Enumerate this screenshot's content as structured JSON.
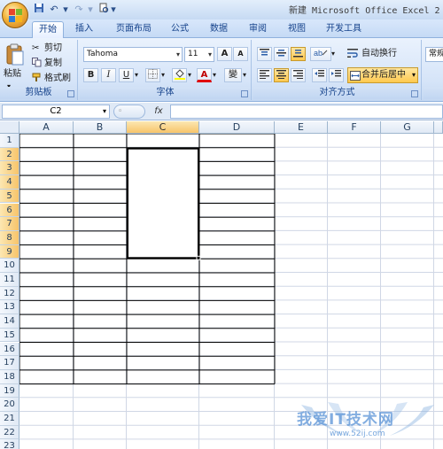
{
  "title": "新建 Microsoft Office Excel 2",
  "quick_access": {
    "undo_label": "↶",
    "redo_label": "↷",
    "more_label": "▾"
  },
  "tabs": [
    "开始",
    "插入",
    "页面布局",
    "公式",
    "数据",
    "审阅",
    "视图",
    "开发工具"
  ],
  "active_tab": "开始",
  "clipboard": {
    "paste": "粘贴",
    "cut": "剪切",
    "copy": "复制",
    "format_painter": "格式刷",
    "group": "剪贴板"
  },
  "font": {
    "name": "Tahoma",
    "size": "11",
    "grow": "A",
    "shrink": "A",
    "bold": "B",
    "italic": "I",
    "underline": "U",
    "phonetic": "變",
    "font_color": "A",
    "group": "字体"
  },
  "alignment": {
    "wrap_text": "自动换行",
    "merge_center": "合并后居中",
    "group": "对齐方式"
  },
  "number": {
    "format": "常规"
  },
  "formula_bar": {
    "name_box": "C2",
    "fx": "fx",
    "value": ""
  },
  "columns": [
    "A",
    "B",
    "C",
    "D",
    "E",
    "F",
    "G"
  ],
  "rows": [
    "1",
    "2",
    "3",
    "4",
    "5",
    "6",
    "7",
    "8",
    "9",
    "10",
    "11",
    "12",
    "13",
    "14",
    "15",
    "16",
    "17",
    "18",
    "19",
    "20",
    "21",
    "22",
    "23"
  ],
  "selected_column": "C",
  "selected_rows": [
    "2",
    "3",
    "4",
    "5",
    "6",
    "7",
    "8",
    "9"
  ],
  "colors": {
    "selection_header": "#f7c46a",
    "ribbon": "#d5e4f8",
    "accent": "#15428b"
  },
  "watermark": {
    "text": "我爱IT技术网",
    "url": "www.52ij.com"
  }
}
